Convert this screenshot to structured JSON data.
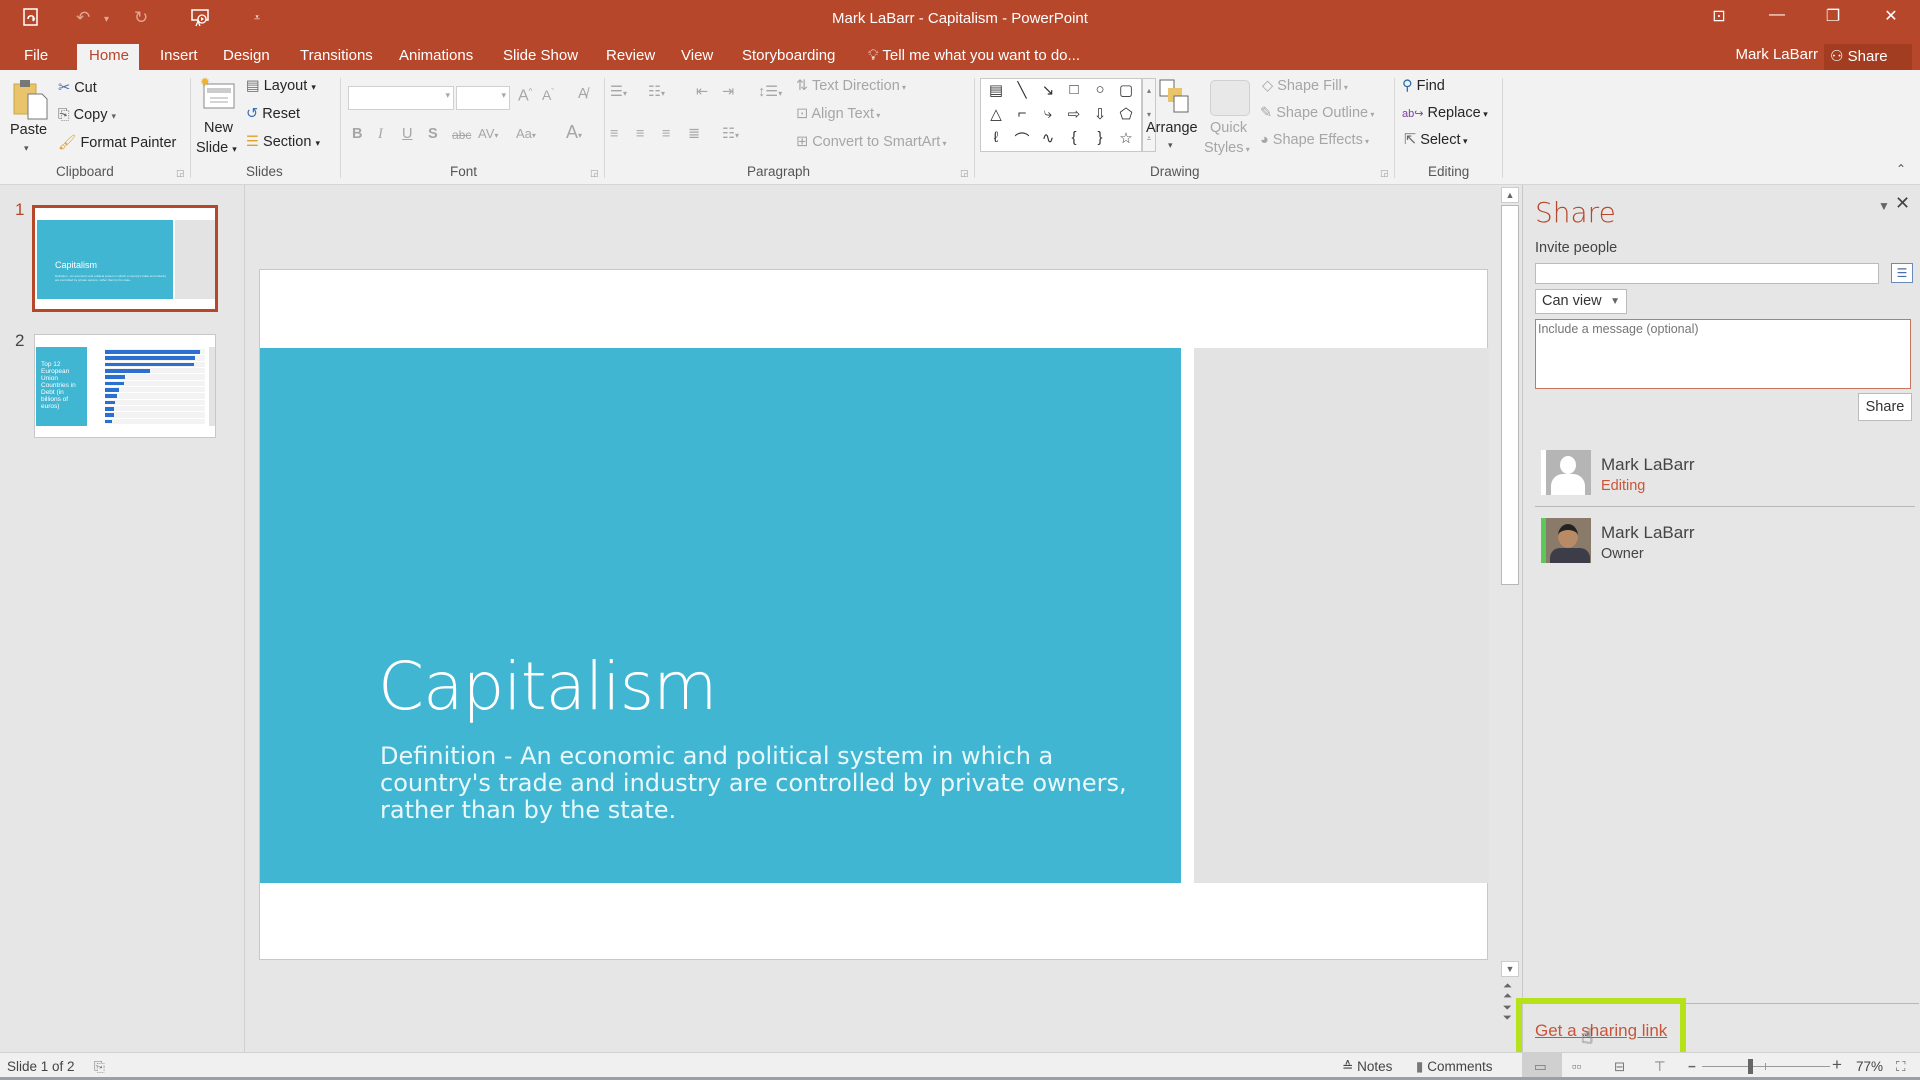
{
  "window": {
    "title": "Mark LaBarr - Capitalism - PowerPoint",
    "quick_access": {
      "save_icon": "powerpoint-save-icon",
      "undo_icon": "undo-icon",
      "redo_icon": "redo-icon",
      "present_icon": "start-from-beginning-icon",
      "customize_icon": "customize-quick-access-icon"
    },
    "controls": [
      "ribbon-display-options",
      "minimize",
      "restore",
      "close"
    ],
    "glyphs": {
      "ribbon_display": "⊡",
      "minimize": "—",
      "restore": "❐",
      "close": "✕"
    }
  },
  "tabs": [
    "File",
    "Home",
    "Insert",
    "Design",
    "Transitions",
    "Animations",
    "Slide Show",
    "Review",
    "View",
    "Storyboarding"
  ],
  "active_tab": "Home",
  "tell_me": "Tell me what you want to do...",
  "account": {
    "name": "Mark LaBarr",
    "share_label": "Share"
  },
  "ribbon": {
    "clipboard": {
      "label": "Clipboard",
      "paste": "Paste",
      "cut": "Cut",
      "copy": "Copy",
      "format_painter": "Format Painter"
    },
    "slides": {
      "label": "Slides",
      "new_slide_1": "New",
      "new_slide_2": "Slide",
      "layout": "Layout",
      "reset": "Reset",
      "section": "Section"
    },
    "font": {
      "label": "Font",
      "font_name": "",
      "font_size": "",
      "bold": "B",
      "italic": "I",
      "underline": "U",
      "shadow": "S",
      "strike": "abc",
      "spacing": "AV",
      "case": "Aa",
      "color": "A"
    },
    "paragraph": {
      "label": "Paragraph",
      "text_direction": "Text Direction",
      "align_text": "Align Text",
      "convert_smartart": "Convert to SmartArt"
    },
    "drawing": {
      "label": "Drawing",
      "arrange": "Arrange",
      "quick_styles_1": "Quick",
      "quick_styles_2": "Styles",
      "shape_fill": "Shape Fill",
      "shape_outline": "Shape Outline",
      "shape_effects": "Shape Effects",
      "shapes": [
        "text-box",
        "line",
        "arrow",
        "rectangle",
        "oval",
        "rounded-rectangle",
        "triangle",
        "elbow-connector",
        "elbow-arrow",
        "right-arrow",
        "down-arrow",
        "flowchart",
        "freeform",
        "arc",
        "curve",
        "left-brace",
        "right-brace",
        "star"
      ],
      "shape_glyphs": [
        "▤",
        "╲",
        "↘",
        "□",
        "○",
        "▢",
        "△",
        "⌐",
        "⤷",
        "⇨",
        "⇩",
        "⬠",
        "ℓ",
        "⌒",
        "∿",
        "{",
        "}",
        "☆"
      ]
    },
    "editing": {
      "label": "Editing",
      "find": "Find",
      "replace": "Replace",
      "select": "Select"
    }
  },
  "thumbnails": [
    {
      "number": "1",
      "title": "Capitalism",
      "body": "Definition - An economic and political system in which a country's trade and industry are controlled by private owners, rather than by the state.",
      "selected": true
    },
    {
      "number": "2",
      "title": "Top 12 European Union Countries in Debt (in billions of euros)",
      "selected": false,
      "bar_fractions": [
        0.95,
        0.9,
        0.89,
        0.45,
        0.2,
        0.19,
        0.14,
        0.12,
        0.1,
        0.09,
        0.09,
        0.07
      ]
    }
  ],
  "slide": {
    "title": "Capitalism",
    "body": "Definition - An economic and political system in which a country's trade and industry are controlled by private owners, rather than by the state.",
    "accent_color": "#41b6d2"
  },
  "share_pane": {
    "title": "Share",
    "invite_label": "Invite people",
    "invite_value": "",
    "permission": "Can view",
    "message_placeholder": "Include a message (optional)",
    "share_button": "Share",
    "people": [
      {
        "name": "Mark LaBarr",
        "role": "Editing",
        "avatar": "default-avatar"
      },
      {
        "name": "Mark LaBarr",
        "role": "Owner",
        "avatar": "photo-avatar"
      }
    ],
    "sharing_link": "Get a sharing link"
  },
  "status": {
    "slide_indicator": "Slide 1 of 2",
    "notes": "Notes",
    "comments": "Comments",
    "zoom": "77%",
    "zoom_fraction": 0.77
  },
  "colors": {
    "brand": "#b7472a",
    "highlight": "#b5e21a",
    "owner_bar": "#5cc85c"
  }
}
